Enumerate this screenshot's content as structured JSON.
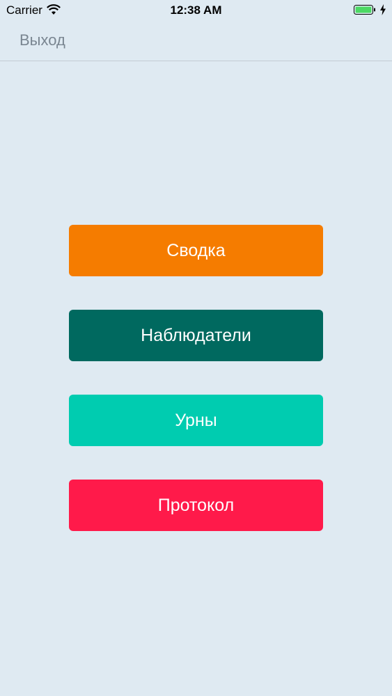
{
  "status_bar": {
    "carrier": "Carrier",
    "time": "12:38 AM",
    "wifi_icon": "wifi-icon",
    "battery_icon": "battery-icon",
    "charging_icon": "charging-bolt-icon"
  },
  "nav": {
    "exit_label": "Выход"
  },
  "menu": {
    "items": [
      {
        "label": "Сводка",
        "color": "#f57c00"
      },
      {
        "label": "Наблюдатели",
        "color": "#00695f"
      },
      {
        "label": "Урны",
        "color": "#00ccb0"
      },
      {
        "label": "Протокол",
        "color": "#ff1a4a"
      }
    ]
  },
  "colors": {
    "background": "#dfeaf2",
    "nav_text": "#7a8691",
    "battery_fill": "#4cd964"
  }
}
